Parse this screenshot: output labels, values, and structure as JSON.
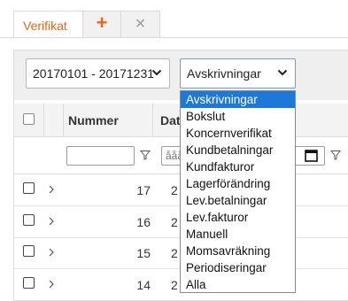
{
  "tabs": {
    "active_label": "Verifikat",
    "add_symbol": "+",
    "close_symbol": "×"
  },
  "filters": {
    "date_range": "20170101 - 20171231",
    "type_selected": "Avskrivningar",
    "type_options": [
      "Avskrivningar",
      "Bokslut",
      "Koncernverifikat",
      "Kundbetalningar",
      "Kundfakturor",
      "Lagerförändring",
      "Lev.betalningar",
      "Lev.fakturor",
      "Manuell",
      "Momsavräkning",
      "Periodiseringar",
      "Alla"
    ]
  },
  "table": {
    "columns": {
      "number": "Nummer",
      "date": "Dat"
    },
    "date_filter_placeholder": "ååå",
    "rows": [
      {
        "number": "17",
        "date_partial": "2"
      },
      {
        "number": "16",
        "date_partial": "2"
      },
      {
        "number": "15",
        "date_partial": "2"
      },
      {
        "number": "14",
        "date_partial": "2"
      }
    ]
  },
  "colors": {
    "accent": "#e8661a",
    "selection": "#1e78d8",
    "focus_border": "#6a9fd6"
  },
  "icons": {
    "add": "plus-icon",
    "close": "close-icon",
    "dropdown": "chevron-down-icon",
    "filter": "filter-icon",
    "calendar": "calendar-icon",
    "expand": "chevron-right-icon"
  }
}
